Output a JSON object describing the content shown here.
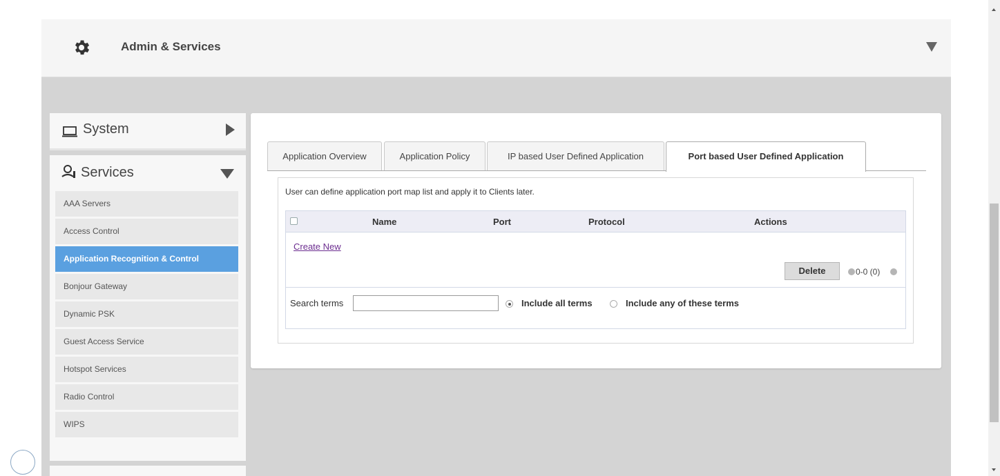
{
  "header": {
    "title": "Admin & Services",
    "icon": "gear-icon"
  },
  "sidebar": {
    "system": {
      "label": "System",
      "icon": "monitor-icon"
    },
    "services": {
      "label": "Services",
      "icon": "services-icon",
      "items": [
        {
          "label": "AAA Servers"
        },
        {
          "label": "Access Control"
        },
        {
          "label": "Application Recognition & Control",
          "active": true
        },
        {
          "label": "Bonjour Gateway"
        },
        {
          "label": "Dynamic PSK"
        },
        {
          "label": "Guest Access Service"
        },
        {
          "label": "Hotspot Services"
        },
        {
          "label": "Radio Control"
        },
        {
          "label": "WIPS"
        }
      ]
    }
  },
  "tabs": [
    {
      "label": "Application Overview"
    },
    {
      "label": "Application Policy"
    },
    {
      "label": "IP based User Defined Application"
    },
    {
      "label": "Port based User Defined Application",
      "active": true
    }
  ],
  "panel": {
    "description": "User can define application port map list and apply it to Clients later.",
    "columns": [
      "Name",
      "Port",
      "Protocol",
      "Actions"
    ],
    "create_link": "Create New",
    "delete_label": "Delete",
    "pager": "0-0 (0)",
    "search": {
      "label": "Search terms",
      "value": "",
      "option_all": "Include all terms",
      "option_any": "Include any of these terms",
      "selected": "all"
    }
  },
  "colors": {
    "active_sidebar": "#5aa0e0",
    "link": "#6b2c8f",
    "page_frame": "#d4d4d4"
  }
}
